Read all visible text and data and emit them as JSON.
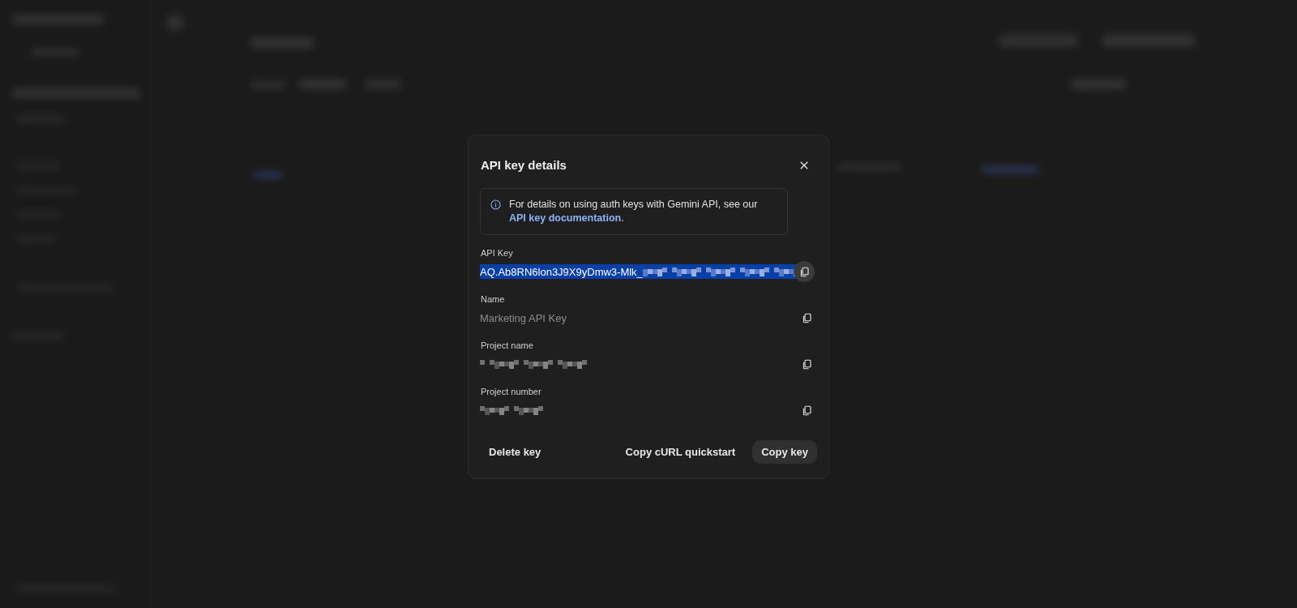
{
  "dialog": {
    "title": "API key details",
    "info": {
      "text": "For details on using auth keys with Gemini API, see our",
      "link": "API key documentation",
      "after_link": "."
    },
    "fields": [
      {
        "label": "API Key",
        "value": "AQ.Ab8RN6lon3J9X9yDmw3-Mlk_",
        "redacted": true,
        "selected": true
      },
      {
        "label": "Name",
        "value": "Marketing API Key",
        "redacted": false,
        "selected": false
      },
      {
        "label": "Project name",
        "redacted": true,
        "selected": false
      },
      {
        "label": "Project number",
        "redacted": true,
        "selected": false
      }
    ],
    "buttons": [
      {
        "label": "Delete key",
        "kind": "text"
      },
      {
        "label": "Copy cURL quickstart",
        "kind": "text"
      },
      {
        "label": "Copy key",
        "kind": "filled"
      }
    ]
  }
}
